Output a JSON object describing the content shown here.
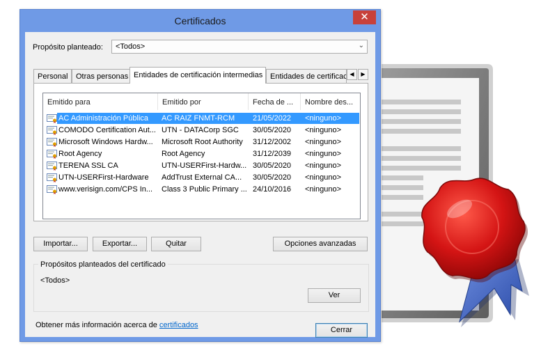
{
  "window": {
    "title": "Certificados",
    "close_glyph": "✕"
  },
  "purpose": {
    "label": "Propósito planteado:",
    "value": "<Todos>",
    "arrow_glyph": "⌄"
  },
  "tabs": [
    {
      "label": "Personal",
      "active": false
    },
    {
      "label": "Otras personas",
      "active": false
    },
    {
      "label": "Entidades de certificación intermedias",
      "active": true
    },
    {
      "label": "Entidades de certificación",
      "active": false
    }
  ],
  "tab_scroll": {
    "left_glyph": "◀",
    "right_glyph": "▶"
  },
  "columns": [
    "Emitido para",
    "Emitido por",
    "Fecha de ...",
    "Nombre des..."
  ],
  "certificates": [
    {
      "issued_to": "AC Administración Pública",
      "issued_by": "AC RAIZ FNMT-RCM",
      "date": "21/05/2022",
      "name": "<ninguno>",
      "selected": true
    },
    {
      "issued_to": "COMODO Certification Aut...",
      "issued_by": "UTN - DATACorp SGC",
      "date": "30/05/2020",
      "name": "<ninguno>",
      "selected": false
    },
    {
      "issued_to": "Microsoft Windows Hardw...",
      "issued_by": "Microsoft Root Authority",
      "date": "31/12/2002",
      "name": "<ninguno>",
      "selected": false
    },
    {
      "issued_to": "Root Agency",
      "issued_by": "Root Agency",
      "date": "31/12/2039",
      "name": "<ninguno>",
      "selected": false
    },
    {
      "issued_to": "TERENA SSL CA",
      "issued_by": "UTN-USERFirst-Hardw...",
      "date": "30/05/2020",
      "name": "<ninguno>",
      "selected": false
    },
    {
      "issued_to": "UTN-USERFirst-Hardware",
      "issued_by": "AddTrust External CA...",
      "date": "30/05/2020",
      "name": "<ninguno>",
      "selected": false
    },
    {
      "issued_to": "www.verisign.com/CPS In...",
      "issued_by": "Class 3 Public Primary ...",
      "date": "24/10/2016",
      "name": "<ninguno>",
      "selected": false
    }
  ],
  "buttons": {
    "import": "Importar...",
    "export": "Exportar...",
    "remove": "Quitar",
    "advanced": "Opciones avanzadas",
    "view": "Ver",
    "close": "Cerrar"
  },
  "purposes_group": {
    "label": "Propósitos planteados del certificado",
    "value": "<Todos>"
  },
  "info": {
    "text": "Obtener más información acerca de ",
    "link": "certificados"
  },
  "colors": {
    "title_bar": "#6f9ae6",
    "close_button": "#c8413a",
    "selection": "#3399ff",
    "seal": "#d41414",
    "link": "#0066cc"
  }
}
